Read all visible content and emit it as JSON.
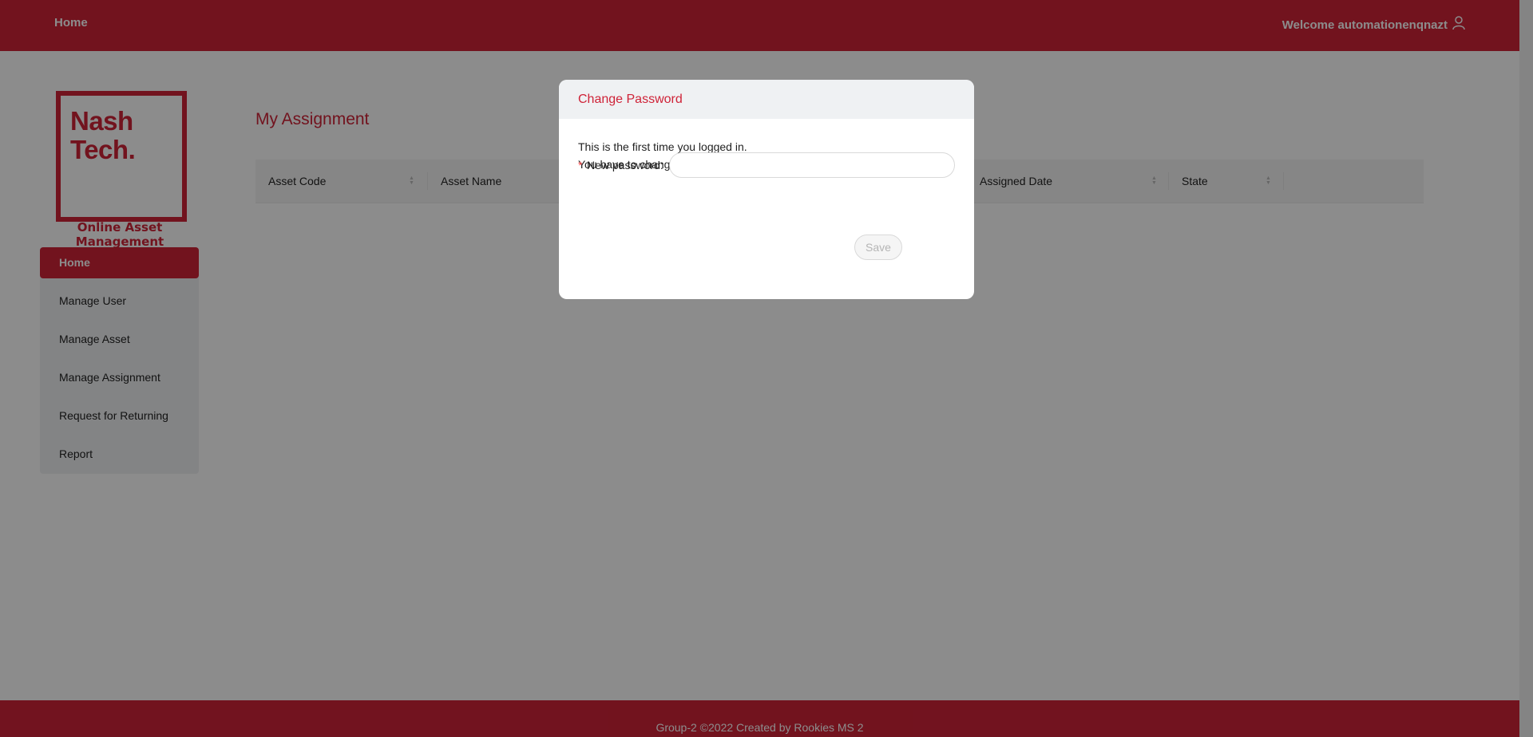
{
  "header": {
    "nav_home": "Home",
    "welcome": "Welcome automationenqnazt",
    "user_icon": "user-icon"
  },
  "sidebar": {
    "logo_line1": "Nash",
    "logo_line2": "Tech.",
    "app_name": "Online Asset Management",
    "items": [
      {
        "label": "Home",
        "active": true
      },
      {
        "label": "Manage User"
      },
      {
        "label": "Manage Asset"
      },
      {
        "label": "Manage Assignment"
      },
      {
        "label": "Request for Returning"
      },
      {
        "label": "Report"
      }
    ]
  },
  "main": {
    "title": "My Assignment",
    "columns": [
      "Asset Code",
      "Asset Name",
      "Assigned Date",
      "State"
    ]
  },
  "modal": {
    "title": "Change Password",
    "message_line1": "This is the first time you logged in.",
    "message_line2": "You have to change your password to continue.",
    "field_required_mark": "*",
    "field_label": "New password:",
    "field_value": "",
    "visibility_icon": "eye-invisible-icon",
    "save_label": "Save"
  },
  "footer": {
    "text": "Group-2 ©2022 Created by Rookies MS 2"
  },
  "colors": {
    "brand": "#cf2338",
    "overlay": "rgba(0,0,0,0.45)"
  }
}
